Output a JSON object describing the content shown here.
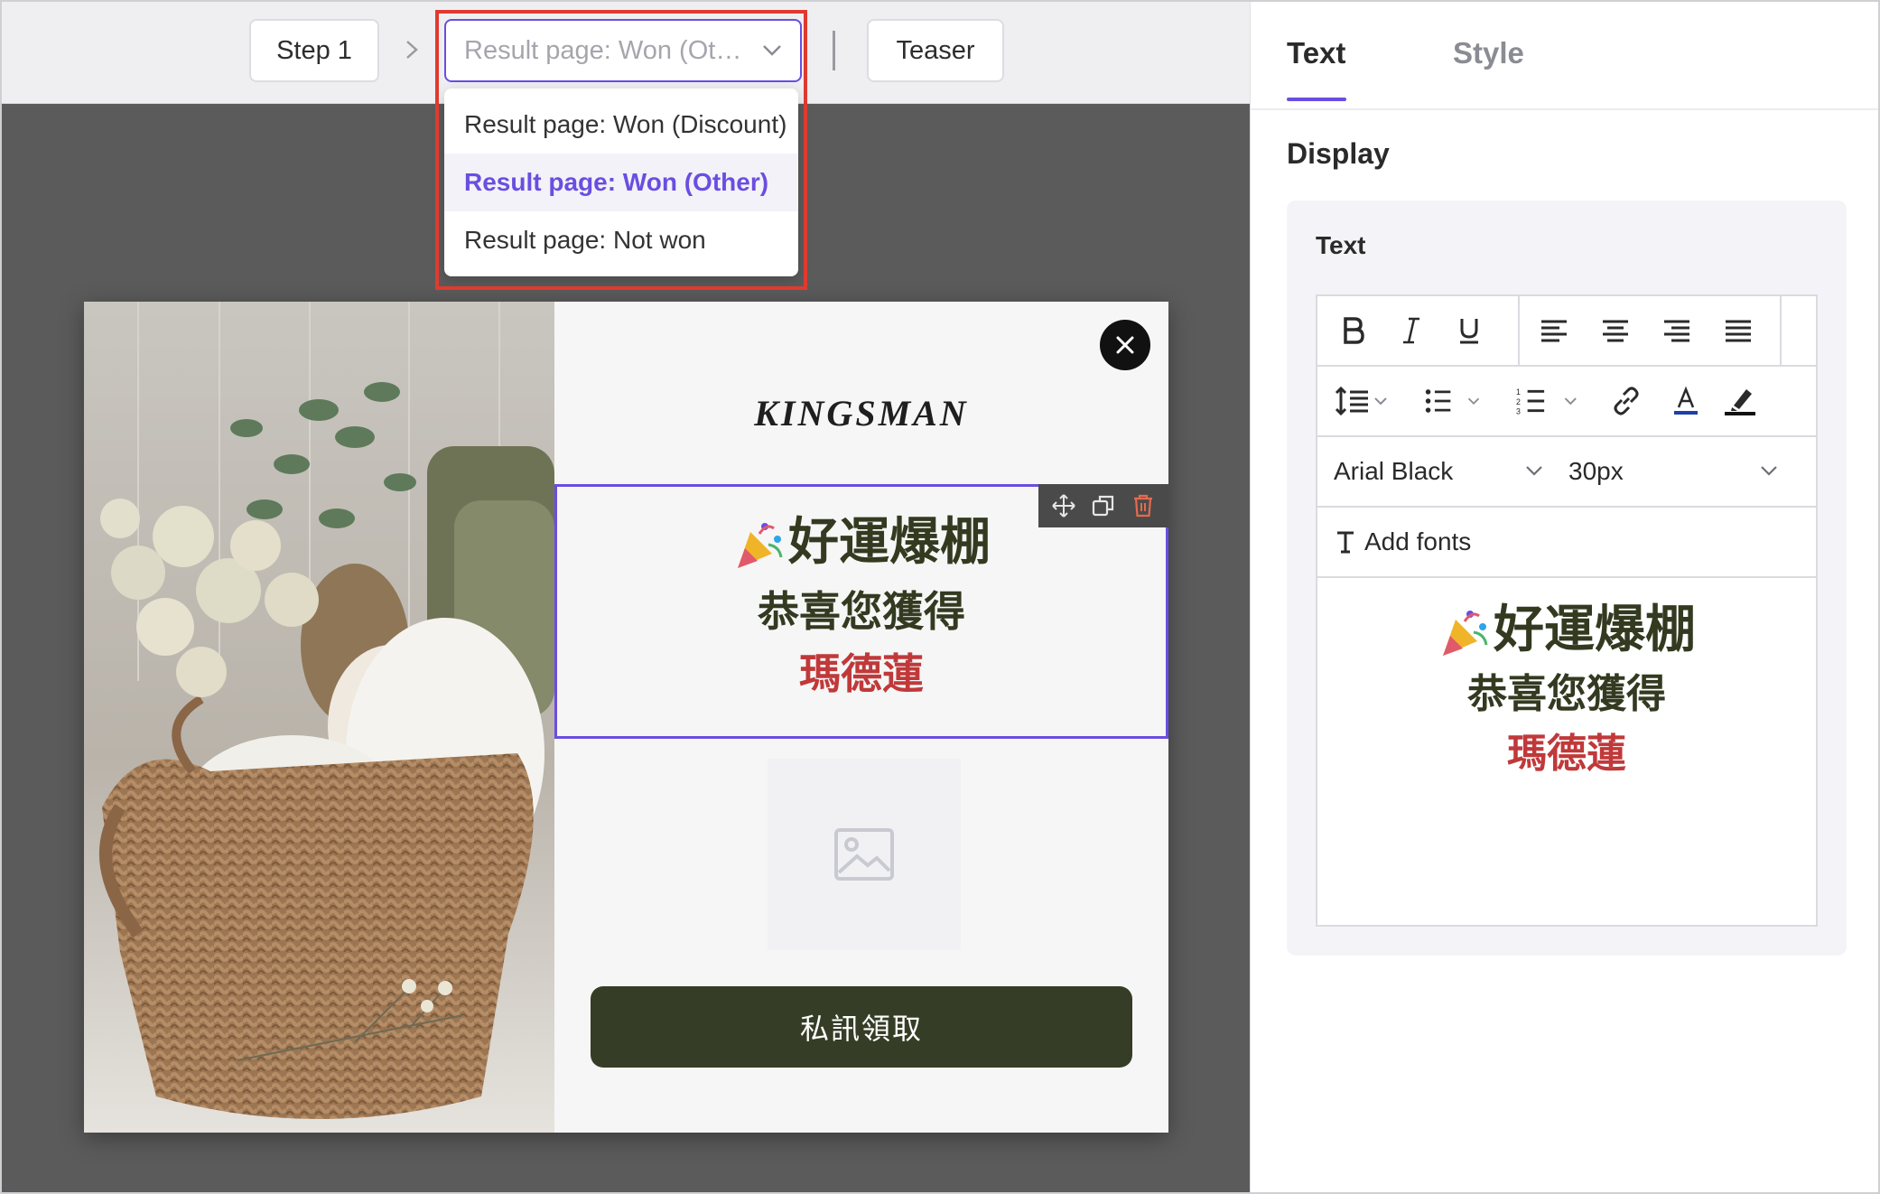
{
  "topbar": {
    "step_label": "Step 1",
    "select_value": "Result page: Won (Other)",
    "teaser_label": "Teaser"
  },
  "dropdown": {
    "options": [
      {
        "label": "Result page: Won (Discount)",
        "selected": false
      },
      {
        "label": "Result page: Won (Other)",
        "selected": true
      },
      {
        "label": "Result page: Not won",
        "selected": false
      }
    ]
  },
  "popup": {
    "brand": "KINGSMAN",
    "headline": "好運爆棚",
    "subline": "恭喜您獲得",
    "prize": "瑪德蓮",
    "cta_label": "私訊領取"
  },
  "panel": {
    "tabs": [
      "Text",
      "Style"
    ],
    "active_tab": "Text",
    "section_title": "Display",
    "field_label": "Text",
    "font_family": "Arial Black",
    "font_size": "30px",
    "add_fonts_label": "Add fonts",
    "preview": {
      "line1": "好運爆棚",
      "line2": "恭喜您獲得",
      "line3": "瑪德蓮"
    }
  },
  "colors": {
    "accent": "#6a4ee0",
    "highlight_box": "#e03a2e",
    "cta_bg": "#353d26",
    "headline_text": "#333a20",
    "prize_text": "#c0393a"
  },
  "icons": [
    "chevron-right-icon",
    "chevron-down-icon",
    "close-icon",
    "move-icon",
    "duplicate-icon",
    "trash-icon",
    "image-placeholder-icon",
    "party-popper-icon",
    "bold-icon",
    "italic-icon",
    "underline-icon",
    "align-left-icon",
    "align-center-icon",
    "align-right-icon",
    "align-justify-icon",
    "line-height-icon",
    "bullet-list-icon",
    "numbered-list-icon",
    "link-icon",
    "text-color-icon",
    "highlight-icon",
    "text-type-icon"
  ]
}
